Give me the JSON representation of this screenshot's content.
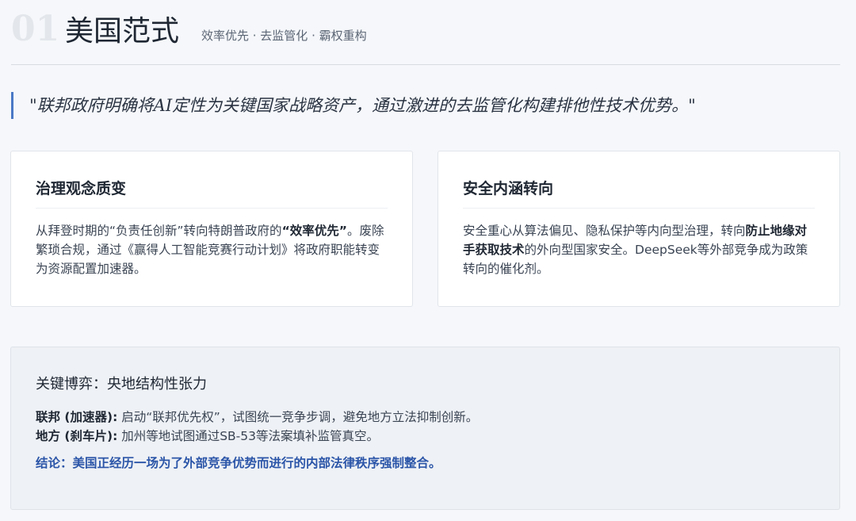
{
  "header": {
    "number": "01",
    "title": "美国范式",
    "subtitle": "效率优先 · 去监管化 · 霸权重构"
  },
  "quote": "\"联邦政府明确将AI定性为关键国家战略资产，通过激进的去监管化构建排他性技术优势。\"",
  "cards": [
    {
      "title": "治理观念质变",
      "body": [
        {
          "text": "从拜登时期的“负责任创新”转向特朗普政府的",
          "bold": false
        },
        {
          "text": "“效率优先”",
          "bold": true
        },
        {
          "text": "。废除繁琐合规，通过《赢得人工智能竞赛行动计划》将政府职能转变为资源配置加速器。",
          "bold": false
        }
      ]
    },
    {
      "title": "安全内涵转向",
      "body": [
        {
          "text": "安全重心从算法偏见、隐私保护等内向型治理，转向",
          "bold": false
        },
        {
          "text": "防止地缘对手获取技术",
          "bold": true
        },
        {
          "text": "的外向型国家安全。DeepSeek等外部竞争成为政策转向的催化剂。",
          "bold": false
        }
      ]
    }
  ],
  "panel": {
    "title": "关键博弈：央地结构性张力",
    "lines": [
      {
        "label": "联邦 (加速器):",
        "text": " 启动“联邦优先权”，试图统一竞争步调，避免地方立法抑制创新。"
      },
      {
        "label": "地方 (刹车片):",
        "text": " 加州等地试图通过SB-53等法案填补监管真空。"
      }
    ],
    "conclusion": "结论：美国正经历一场为了外部竞争优势而进行的内部法律秩序强制整合。"
  },
  "colors": {
    "accent": "#4a78c6",
    "conclusion": "#2b55a8"
  }
}
